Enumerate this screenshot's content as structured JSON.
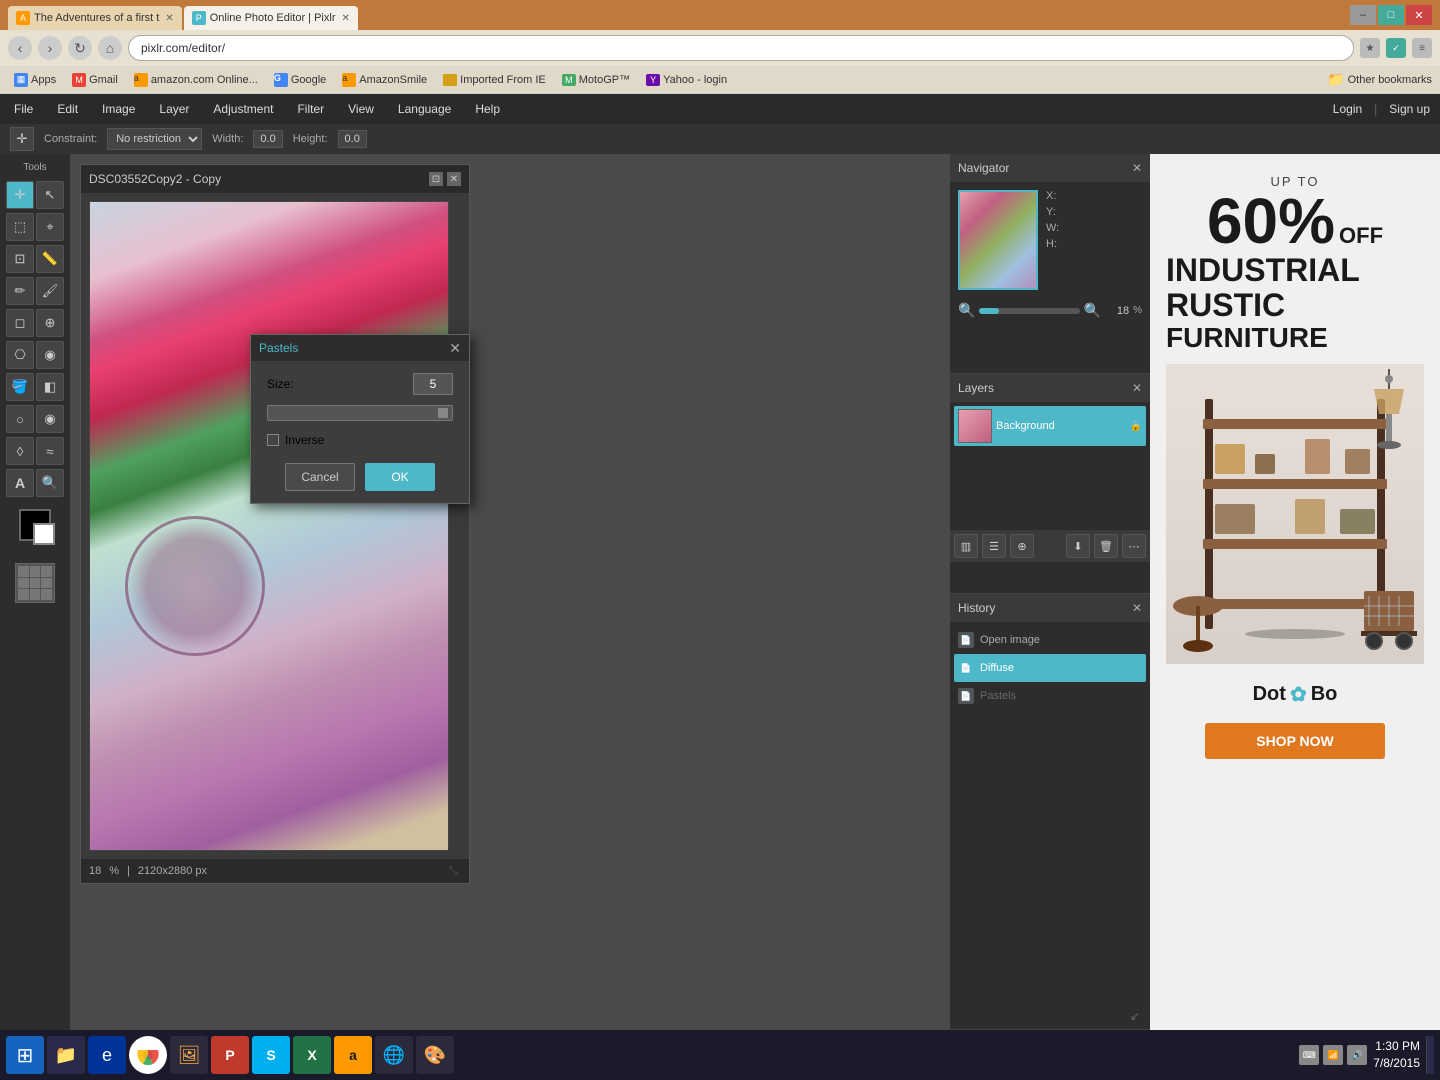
{
  "browser": {
    "tabs": [
      {
        "id": "tab-novel",
        "label": "The Adventures of a first t",
        "active": false,
        "favicon_color": "#f90"
      },
      {
        "id": "tab-pixlr",
        "label": "Online Photo Editor | Pixlr",
        "active": true,
        "favicon_color": "#4db8c8"
      }
    ],
    "controls": {
      "minimize": "–",
      "maximize": "□",
      "close": "✕"
    },
    "address": "pixlr.com/editor/",
    "bookmarks": [
      {
        "id": "bm-apps",
        "label": "Apps",
        "icon": "apps"
      },
      {
        "id": "bm-gmail",
        "label": "Gmail",
        "icon": "gmail"
      },
      {
        "id": "bm-amazon",
        "label": "amazon.com Online...",
        "icon": "amazon"
      },
      {
        "id": "bm-google",
        "label": "Google",
        "icon": "google"
      },
      {
        "id": "bm-amazons",
        "label": "AmazonSmile",
        "icon": "amazons"
      },
      {
        "id": "bm-ie",
        "label": "Imported From IE",
        "icon": "folder"
      },
      {
        "id": "bm-moto",
        "label": "MotoGP™",
        "icon": "folder"
      },
      {
        "id": "bm-yahoo",
        "label": "Yahoo - login",
        "icon": "folder"
      }
    ],
    "other_bookmarks": "Other bookmarks"
  },
  "pixlr": {
    "menu_items": [
      "File",
      "Edit",
      "Image",
      "Layer",
      "Adjustment",
      "Filter",
      "View",
      "Language",
      "Help"
    ],
    "menu_right": [
      "Login",
      "|",
      "Sign up"
    ],
    "toolbar": {
      "constraint_label": "Constraint:",
      "constraint_value": "No restriction",
      "width_label": "Width:",
      "width_value": "0.0",
      "height_label": "Height:",
      "height_value": "0.0"
    },
    "tools": [
      "move",
      "lasso",
      "crop",
      "pencil",
      "eraser",
      "clone",
      "fill",
      "gradient",
      "text",
      "zoom",
      "eyedrop",
      "heal",
      "wand"
    ],
    "tools_label": "Tools"
  },
  "document": {
    "title": "DSC03552Copy2 - Copy",
    "zoom": 18,
    "zoom_unit": "%",
    "dimensions": "2120x2880 px"
  },
  "navigator": {
    "title": "Navigator",
    "x_label": "X:",
    "y_label": "Y:",
    "w_label": "W:",
    "h_label": "H:",
    "zoom_value": "18",
    "zoom_pct": "%"
  },
  "layers": {
    "title": "Layers",
    "items": [
      {
        "id": "layer-bg",
        "name": "Background",
        "selected": true,
        "locked": true
      }
    ],
    "tools": [
      "new-group",
      "new-layer",
      "adjustment-layer",
      "delete",
      "more"
    ]
  },
  "history": {
    "title": "History",
    "items": [
      {
        "id": "hist-open",
        "label": "Open image",
        "selected": false,
        "inactive": false
      },
      {
        "id": "hist-diffuse",
        "label": "Diffuse",
        "selected": true,
        "inactive": false
      },
      {
        "id": "hist-pastels",
        "label": "Pastels",
        "selected": false,
        "inactive": true
      }
    ]
  },
  "dialog": {
    "title": "Pastels",
    "size_label": "Size:",
    "size_value": "5",
    "inverse_label": "Inverse",
    "cancel_label": "Cancel",
    "ok_label": "OK"
  },
  "ad": {
    "up_to": "UP TO",
    "percent": "60%",
    "off": "OFF",
    "line1": "INDUSTRIAL",
    "line2": "RUSTIC",
    "line3": "FURNITURE",
    "brand": "Dot&Bo",
    "shop_now": "SHOP NOW"
  },
  "taskbar": {
    "time": "1:30 PM",
    "date": "7/8/2015",
    "icons": [
      "network",
      "volume",
      "notification"
    ]
  }
}
